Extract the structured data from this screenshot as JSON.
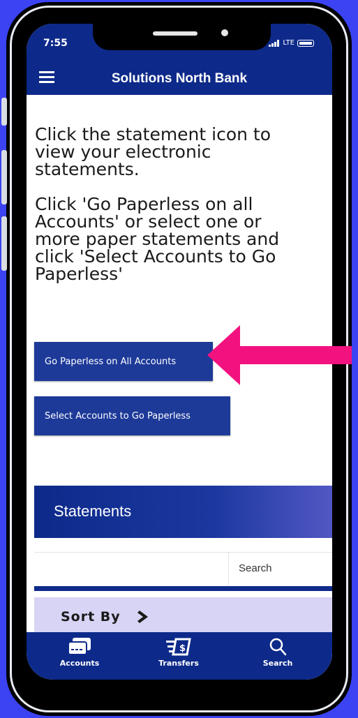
{
  "status": {
    "time": "7:55",
    "carrier": "LTE"
  },
  "header": {
    "title": "Solutions North Bank"
  },
  "instructions": {
    "line1": [
      "Click the statement icon to",
      "view your electronic",
      "statements."
    ],
    "line2": [
      "Click 'Go Paperless on all",
      "Accounts' or select one or",
      "more paper statements and",
      "click 'Select Accounts to Go",
      "Paperless'"
    ]
  },
  "buttons": {
    "go_paperless_all": "Go Paperless on All Accounts",
    "select_accounts": "Select Accounts to Go Paperless"
  },
  "statements": {
    "title": "Statements",
    "search_label": "Search",
    "sort_label": "Sort By"
  },
  "tabbar": [
    {
      "label": "Accounts",
      "icon": "accounts-card-icon"
    },
    {
      "label": "Transfers",
      "icon": "transfers-dollar-icon"
    },
    {
      "label": "Search",
      "icon": "search-icon"
    }
  ],
  "colors": {
    "brand": "#0d2a8a",
    "button": "#1d3a99",
    "sort_bg": "#d8d4f5",
    "arrow": "#f2127f",
    "background": "#3b43f2"
  }
}
